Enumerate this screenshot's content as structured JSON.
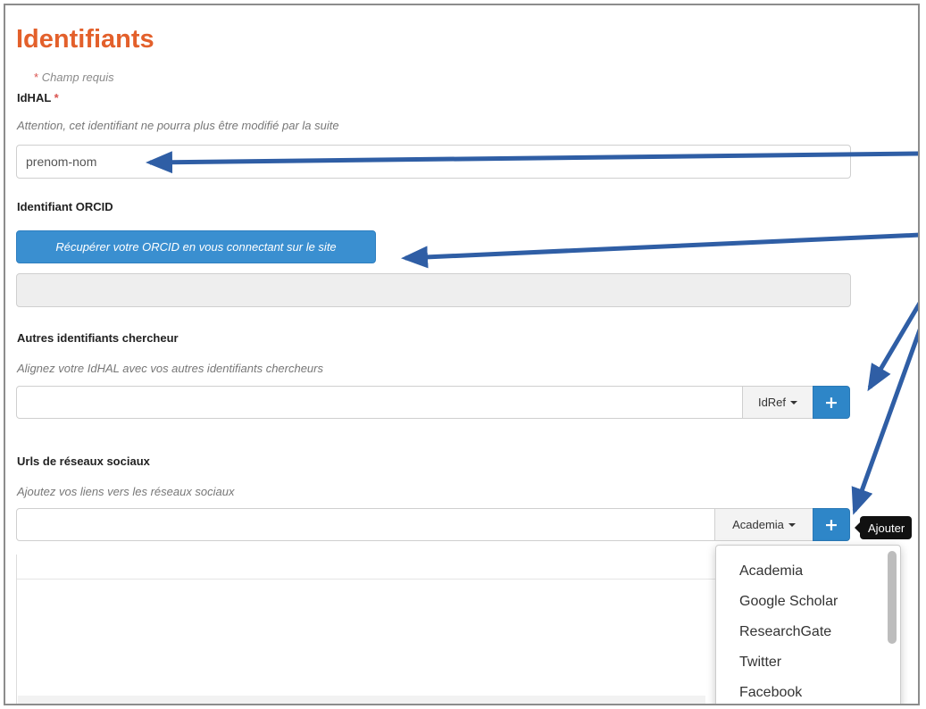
{
  "page": {
    "title": "Identifiants",
    "required_note_star": "*",
    "required_note": "Champ requis"
  },
  "idhal": {
    "label": "IdHAL",
    "required_star": "*",
    "help": "Attention, cet identifiant ne pourra plus être modifié par la suite",
    "placeholder": "prenom-nom"
  },
  "orcid": {
    "label": "Identifiant ORCID",
    "button_label": "Récupérer votre ORCID en vous connectant sur le site",
    "value": ""
  },
  "other_ids": {
    "label": "Autres identifiants chercheur",
    "help": "Alignez votre IdHAL avec vos autres identifiants chercheurs",
    "value": "",
    "selected_type": "IdRef",
    "add_label": "+"
  },
  "social": {
    "label": "Urls de réseaux sociaux",
    "help": "Ajoutez vos liens vers les réseaux sociaux",
    "value": "",
    "selected_type": "Academia",
    "add_label": "+",
    "tooltip": "Ajouter",
    "options": [
      "Academia",
      "Google Scholar",
      "ResearchGate",
      "Twitter",
      "Facebook"
    ]
  },
  "colors": {
    "title": "#e3602b",
    "primary": "#2e86c8",
    "annotation_arrow": "#2f5ea5",
    "required": "#d9534f"
  },
  "icons": {
    "caret": "caret-down-icon",
    "add": "plus-icon",
    "annotation": "arrow-annotation-icon"
  }
}
